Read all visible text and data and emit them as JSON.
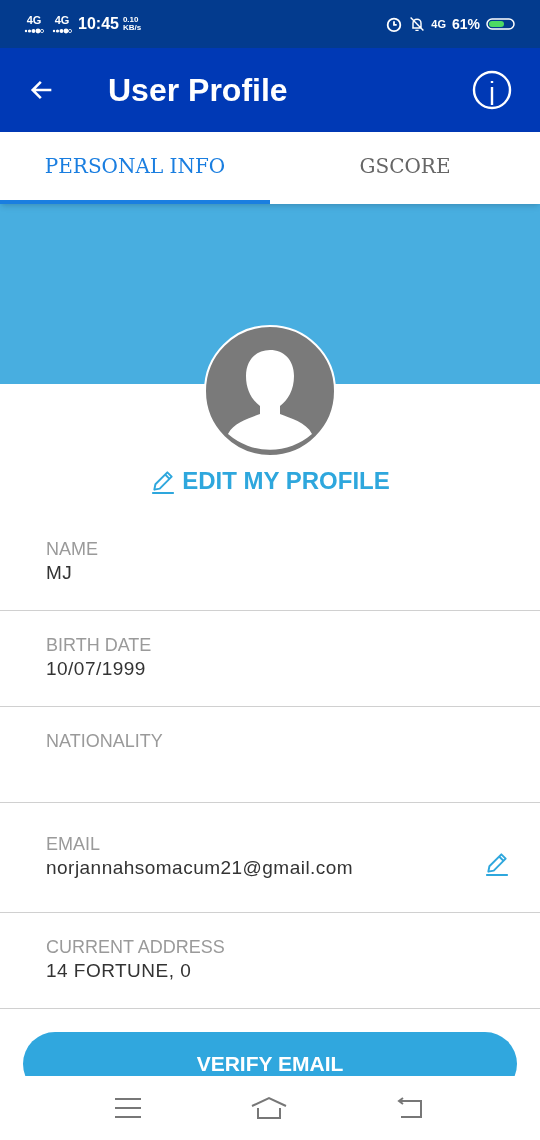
{
  "status_bar": {
    "network_1": "4G",
    "network_2": "4G",
    "time": "10:45",
    "speed": "0.10",
    "speed_unit": "KB/s",
    "network_3": "4G",
    "battery": "61%"
  },
  "app_bar": {
    "title": "User Profile"
  },
  "tabs": [
    {
      "label": "PERSONAL INFO",
      "selected": true
    },
    {
      "label": "GSCORE",
      "selected": false
    }
  ],
  "edit_profile": "EDIT MY PROFILE",
  "fields": [
    {
      "label": "NAME",
      "value": "MJ",
      "editable": false
    },
    {
      "label": "BIRTH DATE",
      "value": "10/07/1999",
      "editable": false
    },
    {
      "label": "NATIONALITY",
      "editable": false
    },
    {
      "label": "EMAIL",
      "value": "norjannahsomacum21@gmail.com",
      "editable": true
    },
    {
      "label": "CURRENT ADDRESS",
      "value": "14 FORTUNE, 0",
      "editable": false
    }
  ],
  "button": "VERIFY EMAIL"
}
